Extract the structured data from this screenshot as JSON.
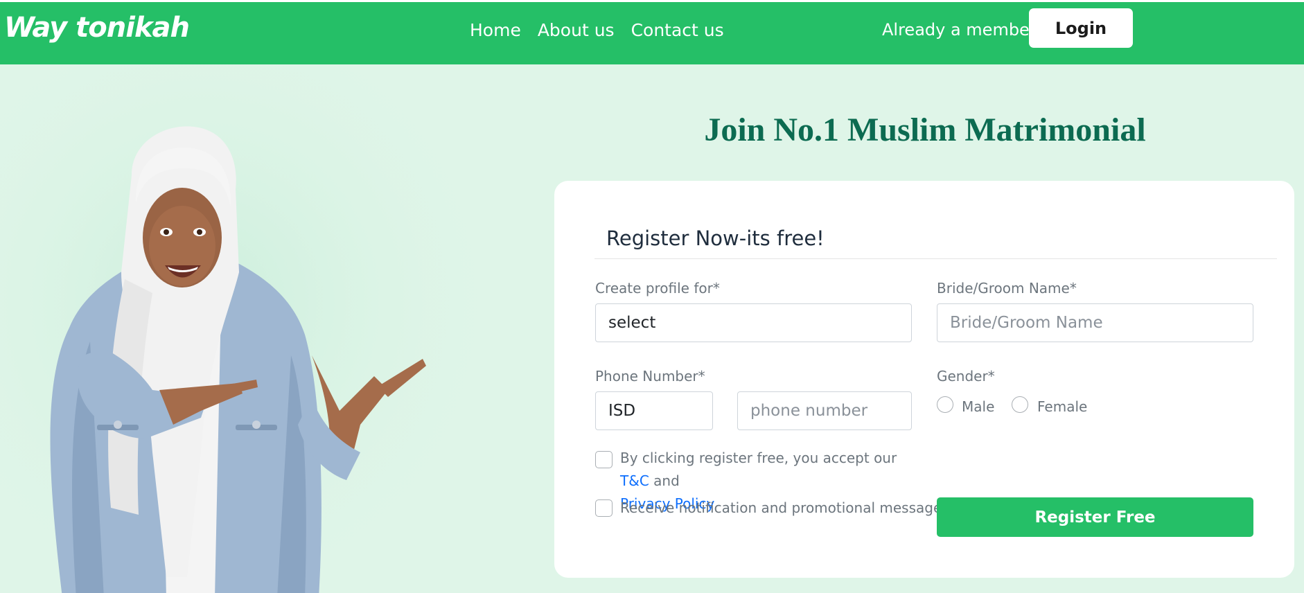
{
  "brand": {
    "logo_text": "Way tonikah",
    "accent": "#25bf67",
    "title_color": "#0c6b51"
  },
  "nav": {
    "items": [
      "Home",
      "About us",
      "Contact us"
    ]
  },
  "header": {
    "member_text": "Already a member?",
    "login_label": "Login"
  },
  "hero": {
    "image": "woman-in-hijab-pointing"
  },
  "main": {
    "title": "Join No.1 Muslim Matrimonial"
  },
  "form": {
    "heading": "Register Now-its free!",
    "profile_for": {
      "label": "Create profile for*",
      "value": "select"
    },
    "name": {
      "label": "Bride/Groom Name*",
      "placeholder": "Bride/Groom Name"
    },
    "phone": {
      "label": "Phone Number*",
      "isd_value": "ISD",
      "placeholder": "phone number"
    },
    "gender": {
      "label": "Gender*",
      "options": [
        "Male",
        "Female"
      ]
    },
    "terms": {
      "prefix": "By clicking register free, you accept our",
      "tc_link": "T&C",
      "and": "and",
      "privacy_link": "Privacy Policy"
    },
    "notify_label": "Receive notification and promotional messages",
    "submit_label": "Register Free"
  }
}
